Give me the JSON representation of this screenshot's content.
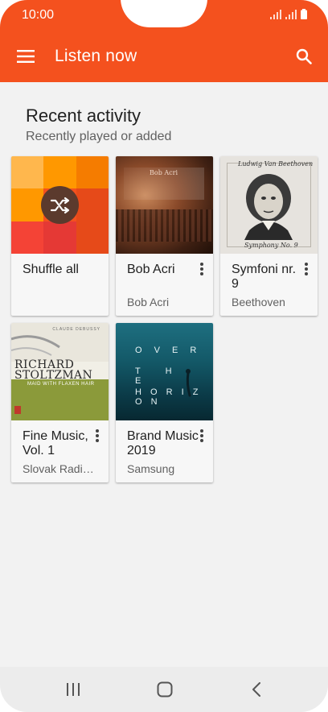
{
  "status_bar": {
    "time": "10:00"
  },
  "app_bar": {
    "title": "Listen now"
  },
  "section": {
    "title": "Recent activity",
    "subtitle": "Recently played or added"
  },
  "cards": [
    {
      "title": "Shuffle all",
      "subtitle": ""
    },
    {
      "title": "Bob Acri",
      "subtitle": "Bob Acri"
    },
    {
      "title": "Symfoni nr. 9",
      "subtitle": "Beethoven"
    },
    {
      "title": "Fine Music, Vol. 1",
      "subtitle": "Slovak Radio.."
    },
    {
      "title": "Brand Music 2019",
      "subtitle": "Samsung"
    }
  ],
  "album_art_text": {
    "bob_acri": "Bob Acri",
    "beethoven_header": "Ludwig Van Beethoven",
    "beethoven_footer": "Symphony No. 9",
    "fine_music_top": "CLAUDE DEBUSSY",
    "fine_music_line1": "RICHARD",
    "fine_music_line2": "STOLTZMAN",
    "fine_music_line3": "MAID WITH FLAXEN HAIR",
    "horizon_line1": "O V E R",
    "horizon_line2": "T H E",
    "horizon_line3": "H O R I Z O N"
  },
  "colors": {
    "accent": "#f4511e",
    "background": "#f2f2f2"
  },
  "icons": [
    "menu-icon",
    "search-icon",
    "shuffle-icon",
    "more-vert-icon",
    "recents-icon",
    "home-icon",
    "back-icon"
  ]
}
